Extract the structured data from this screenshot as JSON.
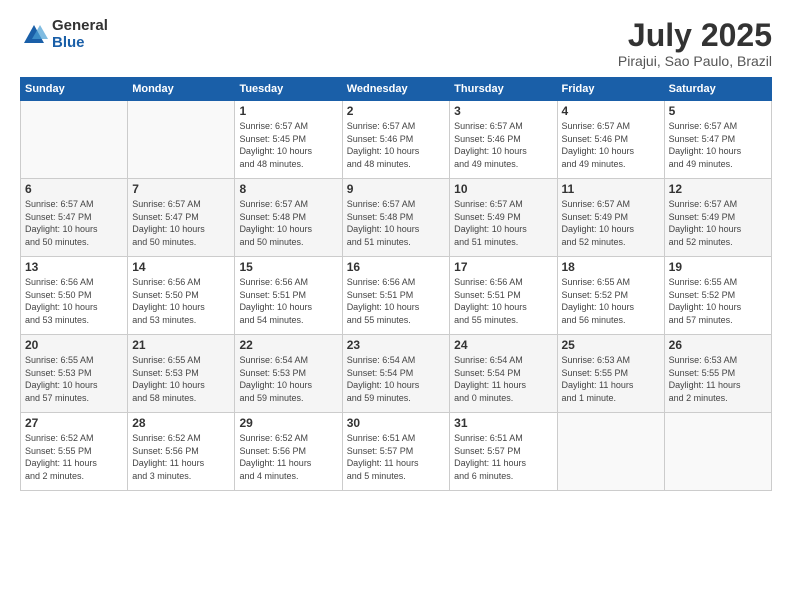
{
  "logo": {
    "general": "General",
    "blue": "Blue"
  },
  "title": "July 2025",
  "subtitle": "Pirajui, Sao Paulo, Brazil",
  "days_header": [
    "Sunday",
    "Monday",
    "Tuesday",
    "Wednesday",
    "Thursday",
    "Friday",
    "Saturday"
  ],
  "weeks": [
    [
      {
        "day": "",
        "info": ""
      },
      {
        "day": "",
        "info": ""
      },
      {
        "day": "1",
        "info": "Sunrise: 6:57 AM\nSunset: 5:45 PM\nDaylight: 10 hours\nand 48 minutes."
      },
      {
        "day": "2",
        "info": "Sunrise: 6:57 AM\nSunset: 5:46 PM\nDaylight: 10 hours\nand 48 minutes."
      },
      {
        "day": "3",
        "info": "Sunrise: 6:57 AM\nSunset: 5:46 PM\nDaylight: 10 hours\nand 49 minutes."
      },
      {
        "day": "4",
        "info": "Sunrise: 6:57 AM\nSunset: 5:46 PM\nDaylight: 10 hours\nand 49 minutes."
      },
      {
        "day": "5",
        "info": "Sunrise: 6:57 AM\nSunset: 5:47 PM\nDaylight: 10 hours\nand 49 minutes."
      }
    ],
    [
      {
        "day": "6",
        "info": "Sunrise: 6:57 AM\nSunset: 5:47 PM\nDaylight: 10 hours\nand 50 minutes."
      },
      {
        "day": "7",
        "info": "Sunrise: 6:57 AM\nSunset: 5:47 PM\nDaylight: 10 hours\nand 50 minutes."
      },
      {
        "day": "8",
        "info": "Sunrise: 6:57 AM\nSunset: 5:48 PM\nDaylight: 10 hours\nand 50 minutes."
      },
      {
        "day": "9",
        "info": "Sunrise: 6:57 AM\nSunset: 5:48 PM\nDaylight: 10 hours\nand 51 minutes."
      },
      {
        "day": "10",
        "info": "Sunrise: 6:57 AM\nSunset: 5:49 PM\nDaylight: 10 hours\nand 51 minutes."
      },
      {
        "day": "11",
        "info": "Sunrise: 6:57 AM\nSunset: 5:49 PM\nDaylight: 10 hours\nand 52 minutes."
      },
      {
        "day": "12",
        "info": "Sunrise: 6:57 AM\nSunset: 5:49 PM\nDaylight: 10 hours\nand 52 minutes."
      }
    ],
    [
      {
        "day": "13",
        "info": "Sunrise: 6:56 AM\nSunset: 5:50 PM\nDaylight: 10 hours\nand 53 minutes."
      },
      {
        "day": "14",
        "info": "Sunrise: 6:56 AM\nSunset: 5:50 PM\nDaylight: 10 hours\nand 53 minutes."
      },
      {
        "day": "15",
        "info": "Sunrise: 6:56 AM\nSunset: 5:51 PM\nDaylight: 10 hours\nand 54 minutes."
      },
      {
        "day": "16",
        "info": "Sunrise: 6:56 AM\nSunset: 5:51 PM\nDaylight: 10 hours\nand 55 minutes."
      },
      {
        "day": "17",
        "info": "Sunrise: 6:56 AM\nSunset: 5:51 PM\nDaylight: 10 hours\nand 55 minutes."
      },
      {
        "day": "18",
        "info": "Sunrise: 6:55 AM\nSunset: 5:52 PM\nDaylight: 10 hours\nand 56 minutes."
      },
      {
        "day": "19",
        "info": "Sunrise: 6:55 AM\nSunset: 5:52 PM\nDaylight: 10 hours\nand 57 minutes."
      }
    ],
    [
      {
        "day": "20",
        "info": "Sunrise: 6:55 AM\nSunset: 5:53 PM\nDaylight: 10 hours\nand 57 minutes."
      },
      {
        "day": "21",
        "info": "Sunrise: 6:55 AM\nSunset: 5:53 PM\nDaylight: 10 hours\nand 58 minutes."
      },
      {
        "day": "22",
        "info": "Sunrise: 6:54 AM\nSunset: 5:53 PM\nDaylight: 10 hours\nand 59 minutes."
      },
      {
        "day": "23",
        "info": "Sunrise: 6:54 AM\nSunset: 5:54 PM\nDaylight: 10 hours\nand 59 minutes."
      },
      {
        "day": "24",
        "info": "Sunrise: 6:54 AM\nSunset: 5:54 PM\nDaylight: 11 hours\nand 0 minutes."
      },
      {
        "day": "25",
        "info": "Sunrise: 6:53 AM\nSunset: 5:55 PM\nDaylight: 11 hours\nand 1 minute."
      },
      {
        "day": "26",
        "info": "Sunrise: 6:53 AM\nSunset: 5:55 PM\nDaylight: 11 hours\nand 2 minutes."
      }
    ],
    [
      {
        "day": "27",
        "info": "Sunrise: 6:52 AM\nSunset: 5:55 PM\nDaylight: 11 hours\nand 2 minutes."
      },
      {
        "day": "28",
        "info": "Sunrise: 6:52 AM\nSunset: 5:56 PM\nDaylight: 11 hours\nand 3 minutes."
      },
      {
        "day": "29",
        "info": "Sunrise: 6:52 AM\nSunset: 5:56 PM\nDaylight: 11 hours\nand 4 minutes."
      },
      {
        "day": "30",
        "info": "Sunrise: 6:51 AM\nSunset: 5:57 PM\nDaylight: 11 hours\nand 5 minutes."
      },
      {
        "day": "31",
        "info": "Sunrise: 6:51 AM\nSunset: 5:57 PM\nDaylight: 11 hours\nand 6 minutes."
      },
      {
        "day": "",
        "info": ""
      },
      {
        "day": "",
        "info": ""
      }
    ]
  ]
}
